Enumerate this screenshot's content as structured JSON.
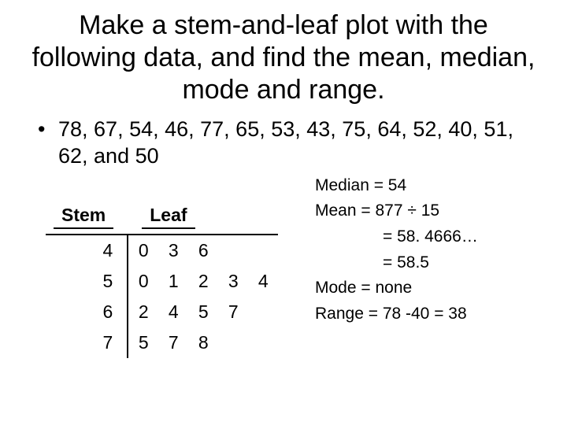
{
  "title": "Make a stem-and-leaf plot with the following data, and find the mean, median, mode and range.",
  "data_line": "78, 67, 54, 46, 77, 65, 53, 43, 75, 64, 52, 40, 51, 62, and 50",
  "bullet_glyph": "•",
  "plot": {
    "stem_header": "Stem",
    "leaf_header": "Leaf",
    "rows": [
      {
        "stem": "4",
        "leaves": [
          "0",
          "3",
          "6",
          "",
          ""
        ]
      },
      {
        "stem": "5",
        "leaves": [
          "0",
          "1",
          "2",
          "3",
          "4"
        ]
      },
      {
        "stem": "6",
        "leaves": [
          "2",
          "4",
          "5",
          "7",
          ""
        ]
      },
      {
        "stem": "7",
        "leaves": [
          "5",
          "7",
          "8",
          "",
          ""
        ]
      }
    ]
  },
  "stats": {
    "median": "Median = 54",
    "mean_expr": "Mean = 877 ÷ 15",
    "mean_decimal": "= 58. 4666…",
    "mean_rounded": "= 58.5",
    "mode": "Mode = none",
    "range": "Range = 78 -40 = 38"
  },
  "chart_data": {
    "type": "table",
    "title": "Stem-and-leaf plot",
    "stems": [
      4,
      5,
      6,
      7
    ],
    "leaves": [
      [
        0,
        3,
        6
      ],
      [
        0,
        1,
        2,
        3,
        4
      ],
      [
        2,
        4,
        5,
        7
      ],
      [
        5,
        7,
        8
      ]
    ],
    "raw_values": [
      78,
      67,
      54,
      46,
      77,
      65,
      53,
      43,
      75,
      64,
      52,
      40,
      51,
      62,
      50
    ],
    "mean": 58.4666,
    "mean_rounded": 58.5,
    "median": 54,
    "mode": null,
    "range": 38
  }
}
